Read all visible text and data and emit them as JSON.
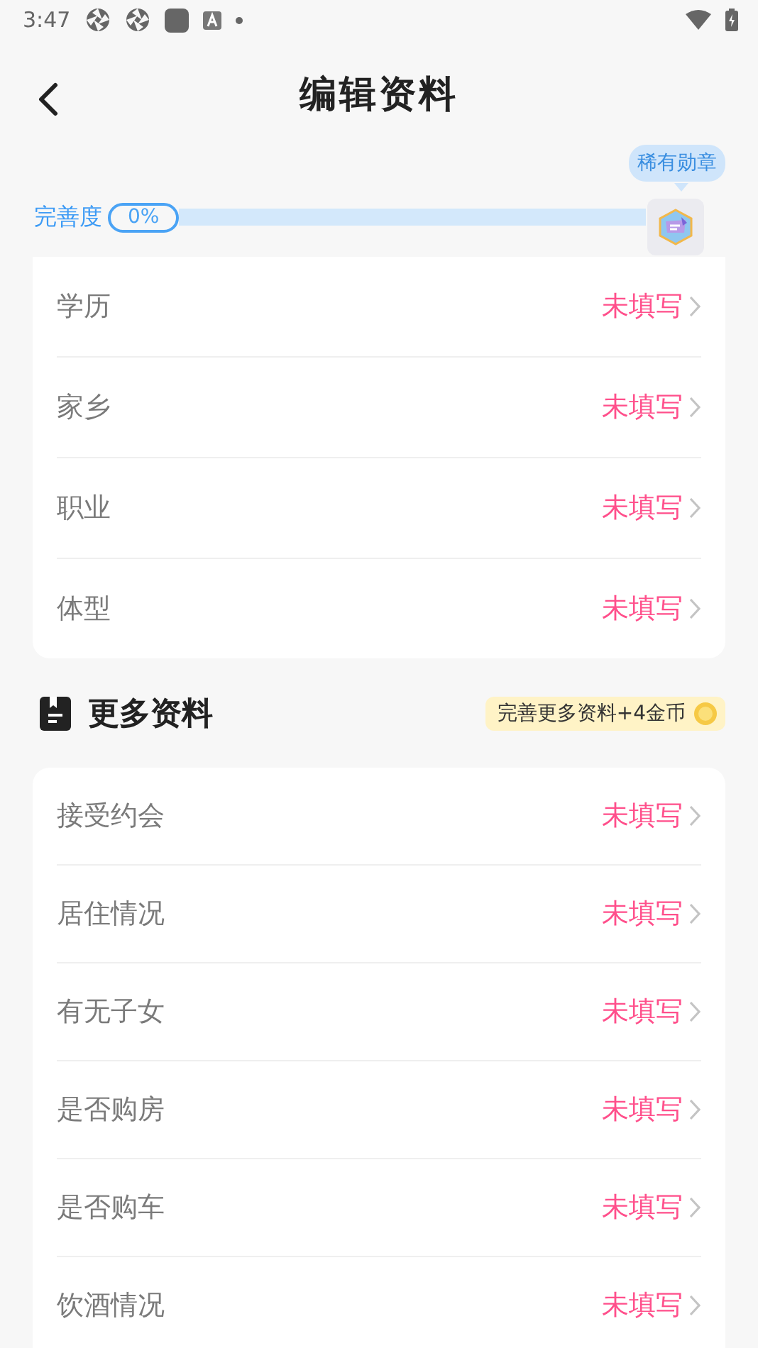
{
  "status_bar": {
    "time": "3:47"
  },
  "header": {
    "title": "编辑资料"
  },
  "completeness": {
    "label": "完善度",
    "percent": "0%",
    "level": 0,
    "badge_tooltip": "稀有勋章"
  },
  "basic_items": [
    {
      "label": "学历",
      "value": "未填写"
    },
    {
      "label": "家乡",
      "value": "未填写"
    },
    {
      "label": "职业",
      "value": "未填写"
    },
    {
      "label": "体型",
      "value": "未填写"
    }
  ],
  "more_section": {
    "title": "更多资料",
    "reward": "完善更多资料+4金币",
    "items": [
      {
        "label": "接受约会",
        "value": "未填写"
      },
      {
        "label": "居住情况",
        "value": "未填写"
      },
      {
        "label": "有无子女",
        "value": "未填写"
      },
      {
        "label": "是否购房",
        "value": "未填写"
      },
      {
        "label": "是否购车",
        "value": "未填写"
      },
      {
        "label": "饮酒情况",
        "value": "未填写"
      }
    ]
  }
}
